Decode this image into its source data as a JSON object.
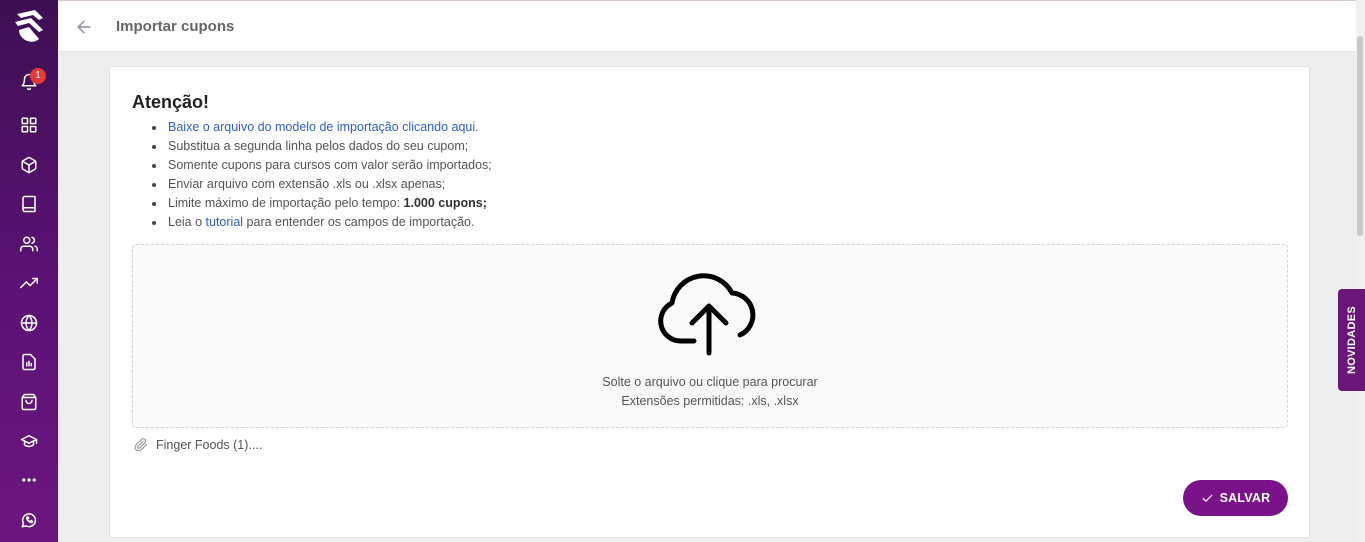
{
  "header": {
    "title": "Importar cupons",
    "back_icon": "arrow-left-icon"
  },
  "sidebar": {
    "logo": "brand-logo",
    "notification_count": "1",
    "items": [
      {
        "icon": "bell-icon"
      },
      {
        "icon": "grid-icon"
      },
      {
        "icon": "box-icon"
      },
      {
        "icon": "book-icon"
      },
      {
        "icon": "users-icon"
      },
      {
        "icon": "trending-up-icon"
      },
      {
        "icon": "globe-icon"
      },
      {
        "icon": "report-icon"
      },
      {
        "icon": "shopping-bag-icon"
      },
      {
        "icon": "graduation-cap-icon"
      },
      {
        "icon": "more-icon"
      },
      {
        "icon": "whatsapp-icon"
      }
    ]
  },
  "notice": {
    "title": "Atenção!",
    "items": {
      "download_link": "Baixe o arquivo do modelo de importação clicando aqui.",
      "replace": "Substitua a segunda linha pelos dados do seu cupom;",
      "paid_only": "Somente cupons para cursos com valor serão importados;",
      "extensions": "Enviar arquivo com extensão .xls ou .xlsx apenas;",
      "limit_prefix": "Limite máximo de importação pelo tempo: ",
      "limit_value": "1.000 cupons;",
      "read_prefix": "Leia o ",
      "tutorial_link": "tutorial",
      "read_suffix": " para entender os campos de importação."
    }
  },
  "dropzone": {
    "icon": "cloud-upload-icon",
    "instruction": "Solte o arquivo ou clique para procurar",
    "allowed": "Extensões permitidas: .xls, .xlsx"
  },
  "attached_file": {
    "icon": "paperclip-icon",
    "name": "Finger Foods (1)...."
  },
  "actions": {
    "save_label": "SALVAR"
  },
  "novidades_tab": "NOVIDADES",
  "colors": {
    "sidebar": "#5c1276",
    "primary_button": "#7a1289",
    "link": "#2f5fc4",
    "badge": "#e53935"
  }
}
